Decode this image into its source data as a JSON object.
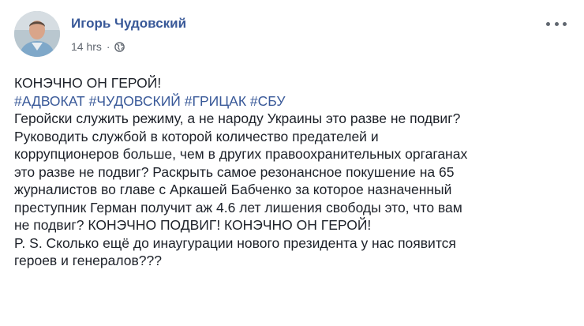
{
  "post": {
    "author_name": "Игорь Чудовский",
    "timestamp": "14 hrs",
    "separator": "·",
    "privacy_icon": "globe-icon",
    "more_icon": "more-horizontal-icon",
    "headline": "КОНЭЧНО ОН ГЕРОЙ!",
    "hashtags": [
      "#АДВОКАТ",
      "#ЧУДОВСКИЙ",
      "#ГРИЦАК",
      "#СБУ"
    ],
    "body_lines": [
      "Геройски служить режиму, а не народу Украины это разве не подвиг?",
      "Руководить службой в которой количество предателей и",
      "коррупционеров больше, чем в других правоохранительных оргаганах",
      "это разве не подвиг? Раскрыть самое резонансное покушение на 65",
      "журналистов во главе с Аркашей Бабченко за которое назначенный",
      "преступник Герман получит аж 4.6 лет лишения свободы это, что вам",
      "не подвиг? КОНЭЧНО ПОДВИГ! КОНЭЧНО ОН ГЕРОЙ!",
      "P. S. Сколько ещё до инаугурации нового президента у нас появится",
      "героев и генералов???"
    ]
  },
  "colors": {
    "link": "#385898",
    "text": "#1d2129",
    "meta": "#616770"
  }
}
